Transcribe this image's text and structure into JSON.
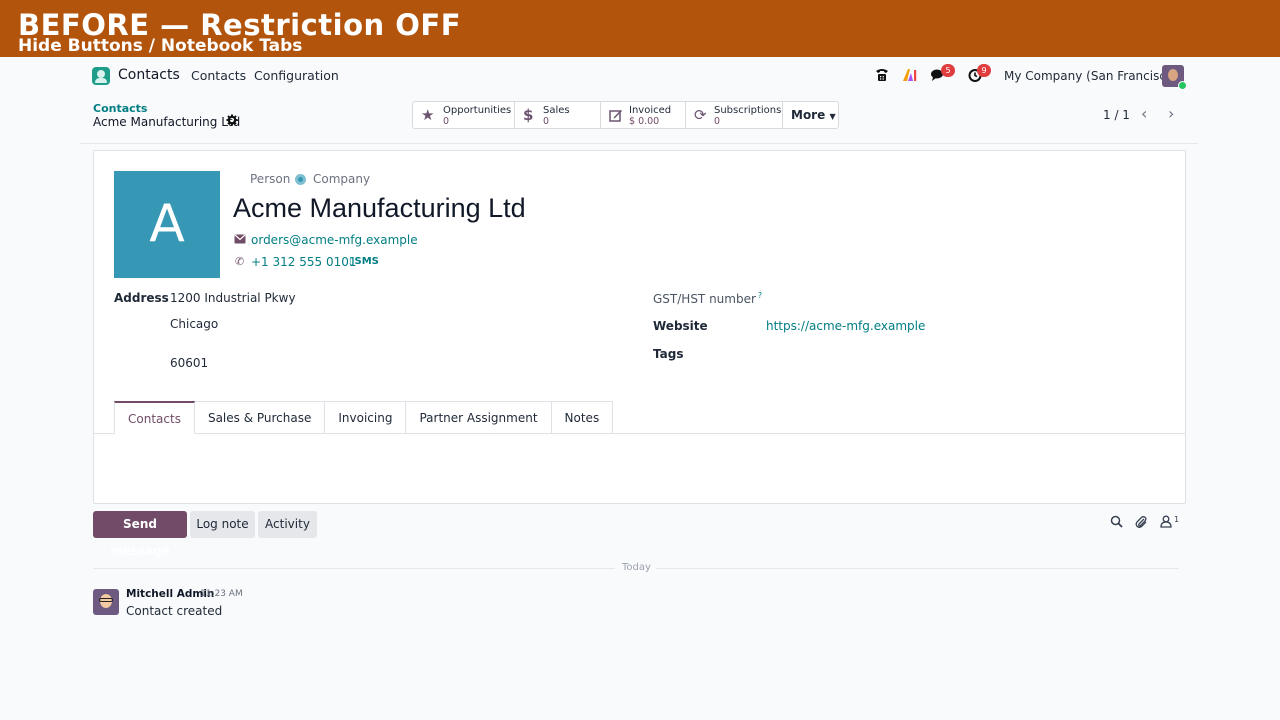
{
  "banner": {
    "title": "BEFORE — Restriction OFF",
    "subtitle": "Hide Buttons / Notebook Tabs"
  },
  "navbar": {
    "app_name": "Contacts",
    "menu": [
      "Contacts",
      "Configuration"
    ],
    "icons": [
      "phone-icon",
      "ai-icon",
      "chat-icon",
      "activity-clock-icon"
    ],
    "messages_badge": "5",
    "activities_badge": "9",
    "company": "My Company (San Francisco)"
  },
  "breadcrumb": {
    "root": "Contacts",
    "current": "Acme Manufacturing Ltd"
  },
  "smart_buttons": [
    {
      "label": "Opportunities",
      "value": "0",
      "icon": "star-icon"
    },
    {
      "label": "Sales",
      "value": "0",
      "icon": "dollar-icon"
    },
    {
      "label": "Invoiced",
      "value": "$ 0.00",
      "icon": "pencil-square-icon"
    },
    {
      "label": "Subscriptions",
      "value": "0",
      "icon": "refresh-icon"
    }
  ],
  "more_label": "More",
  "pager": {
    "value": "1 / 1"
  },
  "form": {
    "avatar_letter": "A",
    "type_person": "Person",
    "type_company": "Company",
    "name": "Acme Manufacturing Ltd",
    "email": "orders@acme-mfg.example",
    "phone": "+1 312 555 0101",
    "sms": "SMS",
    "address_label": "Address",
    "street": "1200 Industrial Pkwy",
    "city": "Chicago",
    "zip": "60601",
    "vat_label": "GST/HST number",
    "vat_help": "?",
    "website_label": "Website",
    "website": "https://acme-mfg.example",
    "tags_label": "Tags"
  },
  "tabs": [
    "Contacts",
    "Sales & Purchase",
    "Invoicing",
    "Partner Assignment",
    "Notes"
  ],
  "chatter": {
    "send_message": "Send message",
    "log_note": "Log note",
    "activity": "Activity",
    "followers_count": "1",
    "today": "Today",
    "message": {
      "author": "Mitchell Admin",
      "time": "11:23 AM",
      "body": "Contact created"
    }
  },
  "colors": {
    "banner": "#b3540d",
    "primary": "#714b67",
    "link": "#017e84",
    "avatar": "#3698b4"
  }
}
